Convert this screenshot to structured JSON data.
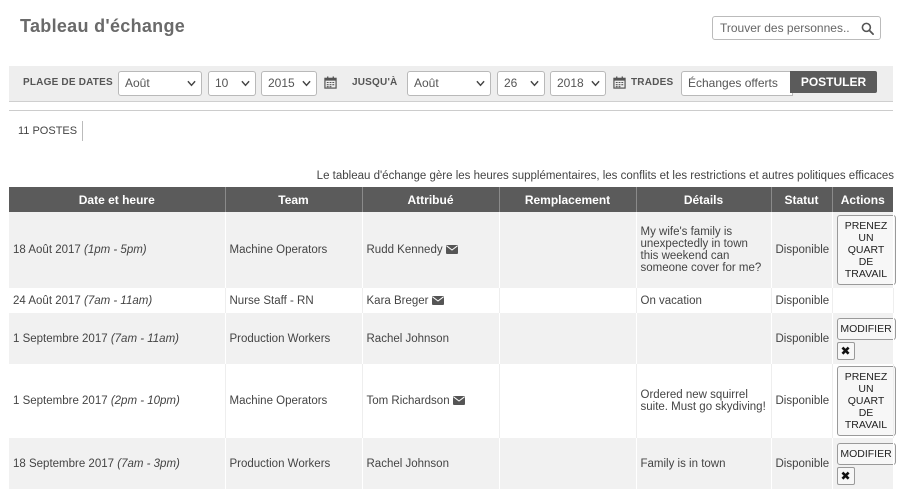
{
  "header": {
    "title": "Tableau d'échange",
    "search_placeholder": "Trouver des personnes.."
  },
  "filters": {
    "date_range_label": "PLAGE DE DATES",
    "from_month": "Août",
    "from_day": "10",
    "from_year": "2015",
    "until_label": "JUSQU'À",
    "to_month": "Août",
    "to_day": "26",
    "to_year": "2018",
    "trades_label": "TRADES",
    "trades_value": "Échanges offerts",
    "submit_label": "POSTULER"
  },
  "summary": {
    "count_label": "11 POSTES",
    "description": "Le tableau d'échange gère les heures supplémentaires, les conflits et les restrictions et autres politiques efficaces"
  },
  "table": {
    "columns": [
      "Date et heure",
      "Team",
      "Attribué",
      "Remplacement",
      "Détails",
      "Statut",
      "Actions"
    ],
    "rows": [
      {
        "date": "18 Août 2017",
        "time": "(1pm - 5pm)",
        "team": "Machine Operators",
        "assigned": "Rudd Kennedy",
        "mail": true,
        "replacement": "",
        "details": "My wife's family is unexpectedly in town this weekend can someone cover for me?",
        "status": "Disponible",
        "action": "PRENEZ UN QUART DE TRAVAIL",
        "delete": false
      },
      {
        "date": "24 Août 2017",
        "time": "(7am - 11am)",
        "team": "Nurse Staff - RN",
        "assigned": "Kara Breger",
        "mail": true,
        "replacement": "",
        "details": "On vacation",
        "status": "Disponible",
        "action": "",
        "delete": false
      },
      {
        "date": "1 Septembre 2017",
        "time": "(7am - 11am)",
        "team": "Production Workers",
        "assigned": "Rachel Johnson",
        "mail": false,
        "replacement": "",
        "details": "",
        "status": "Disponible",
        "action": "MODIFIER",
        "delete": true
      },
      {
        "date": "1 Septembre 2017",
        "time": "(2pm - 10pm)",
        "team": "Machine Operators",
        "assigned": "Tom Richardson",
        "mail": true,
        "replacement": "",
        "details": "Ordered new squirrel suite. Must go skydiving!",
        "status": "Disponible",
        "action": "PRENEZ UN QUART DE TRAVAIL",
        "delete": false
      },
      {
        "date": "18 Septembre 2017",
        "time": "(7am - 3pm)",
        "team": "Production Workers",
        "assigned": "Rachel Johnson",
        "mail": false,
        "replacement": "",
        "details": "Family is in town",
        "status": "Disponible",
        "action": "MODIFIER",
        "delete": true
      }
    ]
  },
  "icons": {
    "search": "search-icon",
    "calendar": "calendar-icon",
    "mail": "envelope-icon",
    "delete": "close-icon",
    "select": "chevron-down-icon"
  },
  "colors": {
    "header_bg": "#5b5b5b",
    "filter_bg": "#eeeeee",
    "row_alt": "#f1f1f1"
  }
}
